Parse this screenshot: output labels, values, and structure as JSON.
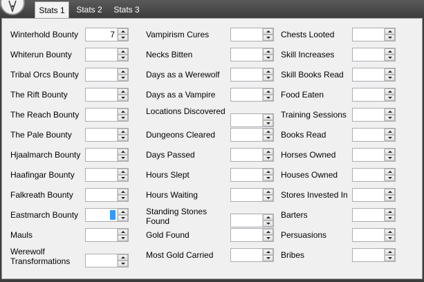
{
  "tabs": [
    {
      "label": "Stats 1",
      "active": true
    },
    {
      "label": "Stats 2",
      "active": false
    },
    {
      "label": "Stats 3",
      "active": false
    }
  ],
  "columns": [
    {
      "fields": [
        {
          "label": "Winterhold Bounty",
          "value": "7"
        },
        {
          "label": "Whiterun Bounty",
          "value": ""
        },
        {
          "label": "Tribal Orcs Bounty",
          "value": ""
        },
        {
          "label": "The Rift Bounty",
          "value": ""
        },
        {
          "label": "The Reach Bounty",
          "value": ""
        },
        {
          "label": "The Pale Bounty",
          "value": ""
        },
        {
          "label": "Hjaalmarch Bounty",
          "value": ""
        },
        {
          "label": "Haafingar Bounty",
          "value": ""
        },
        {
          "label": "Falkreath Bounty",
          "value": ""
        },
        {
          "label": "Eastmarch Bounty",
          "value": "",
          "focused": true
        },
        {
          "label": "Mauls",
          "value": ""
        },
        {
          "label": "Werewolf Transformations",
          "value": ""
        }
      ]
    },
    {
      "fields": [
        {
          "label": "Vampirism Cures",
          "value": ""
        },
        {
          "label": "Necks Bitten",
          "value": ""
        },
        {
          "label": "Days as a Werewolf",
          "value": ""
        },
        {
          "label": "Days as a Vampire",
          "value": ""
        },
        {
          "label": "Locations Discovered",
          "value": ""
        },
        {
          "label": "Dungeons Cleared",
          "value": ""
        },
        {
          "label": "Days Passed",
          "value": ""
        },
        {
          "label": "Hours Slept",
          "value": ""
        },
        {
          "label": "Hours Waiting",
          "value": ""
        },
        {
          "label": "Standing Stones Found",
          "value": ""
        },
        {
          "label": "Gold Found",
          "value": ""
        },
        {
          "label": "Most Gold Carried",
          "value": ""
        }
      ]
    },
    {
      "fields": [
        {
          "label": "Chests Looted",
          "value": ""
        },
        {
          "label": "Skill Increases",
          "value": ""
        },
        {
          "label": "Skill Books Read",
          "value": ""
        },
        {
          "label": "Food Eaten",
          "value": ""
        },
        {
          "label": "Training Sessions",
          "value": ""
        },
        {
          "label": "Books Read",
          "value": ""
        },
        {
          "label": "Horses Owned",
          "value": ""
        },
        {
          "label": "Houses Owned",
          "value": ""
        },
        {
          "label": "Stores Invested In",
          "value": ""
        },
        {
          "label": "Barters",
          "value": ""
        },
        {
          "label": "Persuasions",
          "value": ""
        },
        {
          "label": "Bribes",
          "value": ""
        }
      ]
    }
  ],
  "icons": {
    "logo": "pen-nib-icon",
    "spin_up": "arrow-up-icon",
    "spin_down": "arrow-down-icon"
  }
}
